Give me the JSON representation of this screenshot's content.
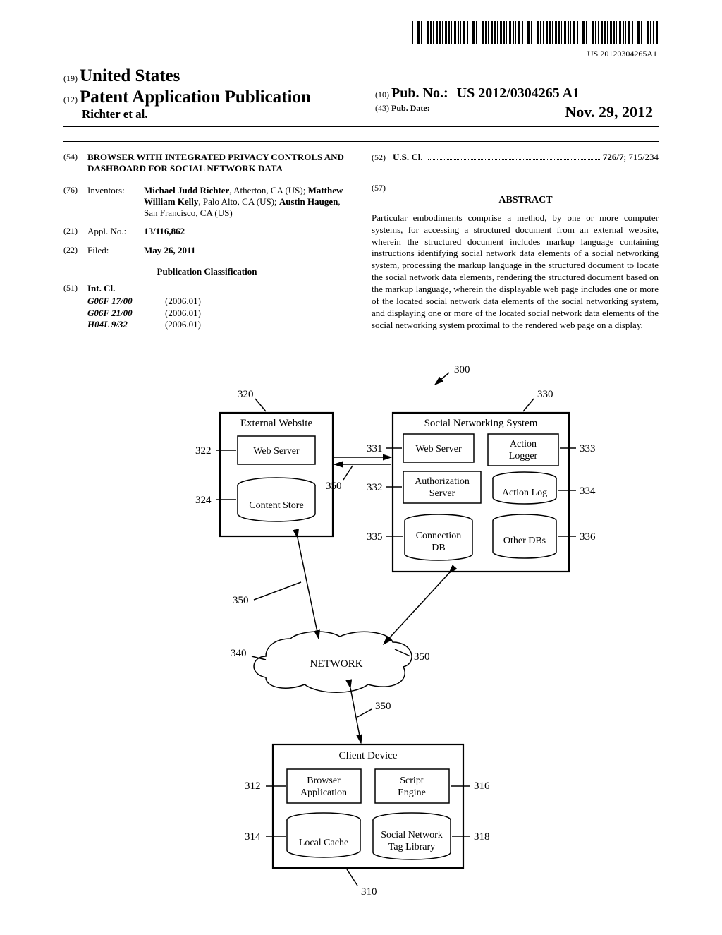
{
  "barcode_text": "US 20120304265A1",
  "header": {
    "country_code": "(19)",
    "country": "United States",
    "doc_type_code": "(12)",
    "doc_type": "Patent Application Publication",
    "authors_line": "Richter et al.",
    "pubno_code": "(10)",
    "pubno_label": "Pub. No.:",
    "pubno_value": "US 2012/0304265 A1",
    "pubdate_code": "(43)",
    "pubdate_label": "Pub. Date:",
    "pubdate_value": "Nov. 29, 2012"
  },
  "left": {
    "title_code": "(54)",
    "title": "BROWSER WITH INTEGRATED PRIVACY CONTROLS AND DASHBOARD FOR SOCIAL NETWORK DATA",
    "inventors_code": "(76)",
    "inventors_label": "Inventors:",
    "inventors_value": "Michael Judd Richter, Atherton, CA (US); Matthew William Kelly, Palo Alto, CA (US); Austin Haugen, San Francisco, CA (US)",
    "inventor_bold_1": "Michael Judd Richter",
    "inventor_rest_1": ", Atherton, CA (US); ",
    "inventor_bold_2": "Matthew William Kelly",
    "inventor_rest_2": ", Palo Alto, CA (US); ",
    "inventor_bold_3": "Austin Haugen",
    "inventor_rest_3": ", San Francisco, CA (US)",
    "applno_code": "(21)",
    "applno_label": "Appl. No.:",
    "applno_value": "13/116,862",
    "filed_code": "(22)",
    "filed_label": "Filed:",
    "filed_value": "May 26, 2011",
    "pub_class_heading": "Publication Classification",
    "intcl_code": "(51)",
    "intcl_label": "Int. Cl.",
    "intcl": [
      {
        "code": "G06F 17/00",
        "year": "(2006.01)"
      },
      {
        "code": "G06F 21/00",
        "year": "(2006.01)"
      },
      {
        "code": "H04L 9/32",
        "year": "(2006.01)"
      }
    ]
  },
  "right": {
    "uscl_code": "(52)",
    "uscl_label": "U.S. Cl.",
    "uscl_value_bold": "726/7",
    "uscl_value_rest": "; 715/234",
    "abstract_code": "(57)",
    "abstract_heading": "ABSTRACT",
    "abstract_text": "Particular embodiments comprise a method, by one or more computer systems, for accessing a structured document from an external website, wherein the structured document includes markup language containing instructions identifying social network data elements of a social networking system, processing the markup language in the structured document to locate the social network data elements, rendering the structured document based on the markup language, wherein the displayable web page includes one or more of the located social network data elements of the social networking system, and displaying one or more of the located social network data elements of the social networking system proximal to the rendered web page on a display."
  },
  "figure": {
    "ref_300": "300",
    "external_website": "External Website",
    "web_server": "Web Server",
    "content_store": "Content Store",
    "social_networking_system": "Social Networking System",
    "action_logger_l1": "Action",
    "action_logger_l2": "Logger",
    "authorization_l1": "Authorization",
    "authorization_l2": "Server",
    "action_log": "Action Log",
    "connection_l1": "Connection",
    "connection_l2": "DB",
    "other_dbs": "Other DBs",
    "network": "NETWORK",
    "client_device": "Client Device",
    "browser_l1": "Browser",
    "browser_l2": "Application",
    "script_l1": "Script",
    "script_l2": "Engine",
    "local_cache": "Local Cache",
    "tag_lib_l1": "Social Network",
    "tag_lib_l2": "Tag Library",
    "n310": "310",
    "n312": "312",
    "n314": "314",
    "n316": "316",
    "n318": "318",
    "n320": "320",
    "n322": "322",
    "n324": "324",
    "n330": "330",
    "n331": "331",
    "n332": "332",
    "n333": "333",
    "n334": "334",
    "n335": "335",
    "n336": "336",
    "n340": "340",
    "n350": "350"
  }
}
